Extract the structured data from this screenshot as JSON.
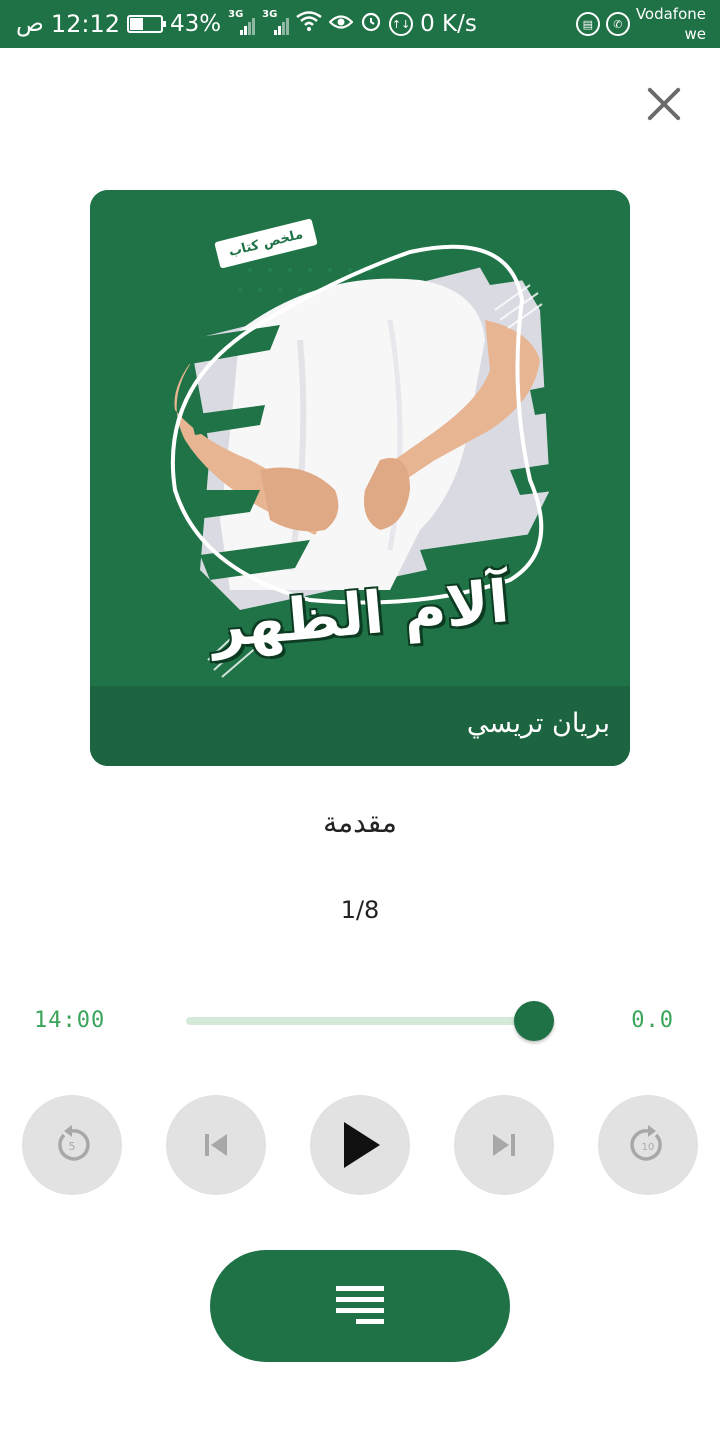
{
  "status_bar": {
    "time": "12:12",
    "am_pm": "ص",
    "battery": "43%",
    "battery_level": 0.43,
    "network_1": "3G",
    "network_2": "3G",
    "speed": "0 K/s",
    "carrier_line1": "Vodafone",
    "carrier_line2": "we",
    "bg_color": "#1e7245"
  },
  "cover": {
    "tag": "ملخص كتاب",
    "title": "آلام الظهر",
    "author": "بريان تريسي",
    "bg_color": "#1f7346"
  },
  "chapter": {
    "title": "مقدمة",
    "count": "1/8"
  },
  "player": {
    "total_time": "14:00",
    "current_time": "0.0",
    "progress": 0.0,
    "rewind_seconds": "5",
    "forward_seconds": "10",
    "accent_color": "#1e7245",
    "text_accent": "#3aa45a"
  },
  "icons": {
    "close": "close-icon",
    "rewind": "rewind-5-icon",
    "previous": "skip-previous-icon",
    "play": "play-icon",
    "next": "skip-next-icon",
    "forward": "forward-10-icon",
    "menu": "chapters-list-icon"
  }
}
